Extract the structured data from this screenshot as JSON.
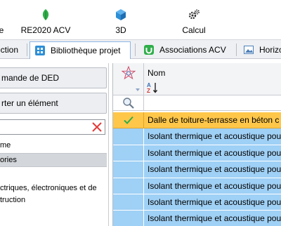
{
  "ribbon": {
    "left_partial_label": "e",
    "re2020_label": "RE2020 ACV",
    "threed_label": "3D",
    "calcul_label": "Calcul"
  },
  "tabs": [
    {
      "label": "uction"
    },
    {
      "label": "Bibliothèque projet",
      "active": true
    },
    {
      "label": "Associations ACV"
    },
    {
      "label": "Horizo"
    }
  ],
  "left_panel": {
    "button1_label": "mande de DED",
    "button2_label": "rter un élément",
    "search_value": "",
    "section_label": "me",
    "category_header": "ories",
    "tree_lines": [
      "ctriques, électroniques et de",
      "truction"
    ]
  },
  "grid": {
    "column_name": "Nom",
    "rows": [
      {
        "text": "Dalle de toiture-terrasse en béton c",
        "selected": true,
        "checked": true
      },
      {
        "text": "Isolant thermique et acoustique pou"
      },
      {
        "text": "Isolant thermique et acoustique pou"
      },
      {
        "text": "Isolant thermique et acoustique pou"
      },
      {
        "text": "Isolant thermique et acoustique pou"
      },
      {
        "text": "Isolant thermique et acoustique pou"
      },
      {
        "text": "Isolant thermique et acoustique pou"
      }
    ]
  },
  "colors": {
    "row_blue": "#9fd0f5",
    "row_selected": "#ffc74a",
    "accent_green": "#2fae4a",
    "accent_blue": "#2e8fd6",
    "clear_red": "#e23a3a"
  },
  "icons": {
    "re2020": "leaf-icon",
    "threed": "cube-icon",
    "calcul": "gears-icon",
    "biblio_tab": "library-icon",
    "assoc_tab": "link-icon",
    "horizon_tab": "image-icon",
    "clear": "close-icon",
    "filter": "magnifier-icon",
    "sort": "sort-az-icon",
    "header": "star-icon",
    "row_check": "checkmark-icon"
  }
}
